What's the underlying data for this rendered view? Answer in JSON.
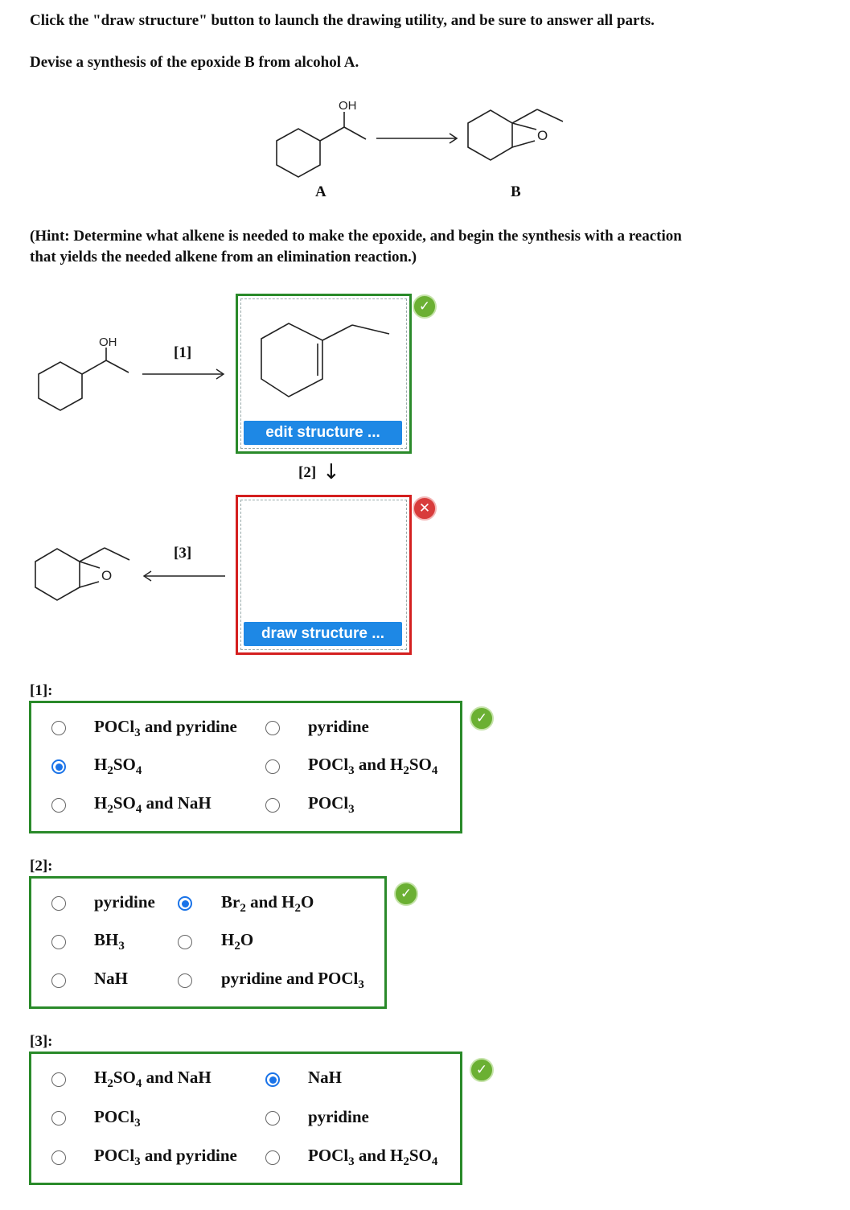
{
  "instructions": "Click the \"draw structure\" button to launch the drawing utility, and be sure to answer all parts.",
  "question": "Devise a synthesis of the epoxide B from alcohol A.",
  "hint_line1": "(Hint: Determine what alkene is needed to make the epoxide, and begin the synthesis with a reaction",
  "hint_line2": "that yields the needed alkene from an elimination reaction.)",
  "scheme": {
    "label_a": "A",
    "label_b": "B",
    "oh": "OH",
    "o": "O"
  },
  "synthesis": {
    "step1": "[1]",
    "step2": "[2]",
    "step3": "[3]",
    "down_arrow": "↓",
    "edit_button": "edit structure ...",
    "draw_button": "draw structure ..."
  },
  "status": {
    "correct_mark": "✓",
    "wrong_mark": "✕"
  },
  "q1": {
    "label": "[1]:",
    "options": [
      "POCl3 and pyridine",
      "pyridine",
      "H2SO4",
      "POCl3 and H2SO4",
      "H2SO4 and NaH",
      "POCl3"
    ],
    "selected": "H2SO4"
  },
  "q2": {
    "label": "[2]:",
    "options": [
      "pyridine",
      "Br2 and H2O",
      "BH3",
      "H2O",
      "NaH",
      "pyridine and POCl3"
    ],
    "selected": "Br2 and H2O"
  },
  "q3": {
    "label": "[3]:",
    "options": [
      "H2SO4 and NaH",
      "NaH",
      "POCl3",
      "pyridine",
      "POCl3 and pyridine",
      "POCl3 and H2SO4"
    ],
    "selected": "NaH"
  }
}
